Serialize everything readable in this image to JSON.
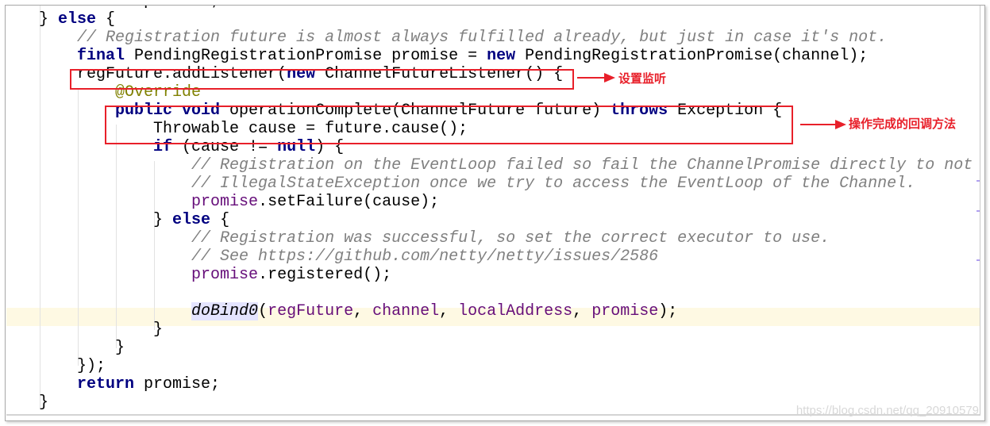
{
  "code_lines": [
    [
      [
        "kw",
        "        return "
      ],
      [
        "",
        "promise;"
      ]
    ],
    [
      [
        "",
        "    } "
      ],
      [
        "kw",
        "else"
      ],
      [
        "",
        " {"
      ]
    ],
    [
      [
        "cm",
        "        // Registration future is almost always fulfilled already, but just in case it's not."
      ]
    ],
    [
      [
        "kw",
        "        final "
      ],
      [
        "",
        "PendingRegistrationPromise promise = "
      ],
      [
        "kw",
        "new "
      ],
      [
        "",
        "PendingRegistrationPromise(channel);"
      ]
    ],
    [
      [
        "",
        "        regFuture.addListener("
      ],
      [
        "kw",
        "new "
      ],
      [
        "",
        "ChannelFutureListener() {"
      ]
    ],
    [
      [
        "an",
        "            @Override"
      ]
    ],
    [
      [
        "kw",
        "            public void "
      ],
      [
        "",
        "operationComplete(ChannelFuture future) "
      ],
      [
        "kw",
        "throws "
      ],
      [
        "",
        "Exception {"
      ]
    ],
    [
      [
        "",
        "                Throwable cause = future.cause();"
      ]
    ],
    [
      [
        "kw",
        "                if "
      ],
      [
        "",
        "(cause != "
      ],
      [
        "kw",
        "null"
      ],
      [
        "",
        ") {"
      ]
    ],
    [
      [
        "cm",
        "                    // Registration on the EventLoop failed so fail the ChannelPromise directly to not cause an"
      ]
    ],
    [
      [
        "cm",
        "                    // IllegalStateException once we try to access the EventLoop of the Channel."
      ]
    ],
    [
      [
        "fd",
        "                    promise"
      ],
      [
        "",
        ".setFailure(cause);"
      ]
    ],
    [
      [
        "",
        "                } "
      ],
      [
        "kw",
        "else"
      ],
      [
        "",
        " {"
      ]
    ],
    [
      [
        "cm",
        "                    // Registration was successful, so set the correct executor to use."
      ]
    ],
    [
      [
        "cm",
        "                    // See https://github.com/netty/netty/issues/2586"
      ]
    ],
    [
      [
        "fd",
        "                    promise"
      ],
      [
        "",
        ".registered();"
      ]
    ],
    [
      [
        "",
        ""
      ]
    ],
    [
      [
        "",
        "                    "
      ],
      [
        "mi",
        "doBind0"
      ],
      [
        "",
        "("
      ],
      [
        "fd",
        "regFuture"
      ],
      [
        "",
        ", "
      ],
      [
        "fd",
        "channel"
      ],
      [
        "",
        ", "
      ],
      [
        "fd",
        "localAddress"
      ],
      [
        "",
        ", "
      ],
      [
        "fd",
        "promise"
      ],
      [
        "",
        ");"
      ]
    ],
    [
      [
        "",
        "                }"
      ]
    ],
    [
      [
        "",
        "            }"
      ]
    ],
    [
      [
        "",
        "        });"
      ]
    ],
    [
      [
        "kw",
        "        return "
      ],
      [
        "",
        "promise;"
      ]
    ],
    [
      [
        "",
        "    }"
      ]
    ]
  ],
  "annotations": {
    "listener_note": "设置监听",
    "callback_note": "操作完成的回调方法"
  },
  "watermark": "https://blog.csdn.net/qq_20910579",
  "colors": {
    "keyword": "#000080",
    "comment": "#808080",
    "field": "#660e7a",
    "annotation": "#808000",
    "highlight_box": "#e8202a"
  }
}
